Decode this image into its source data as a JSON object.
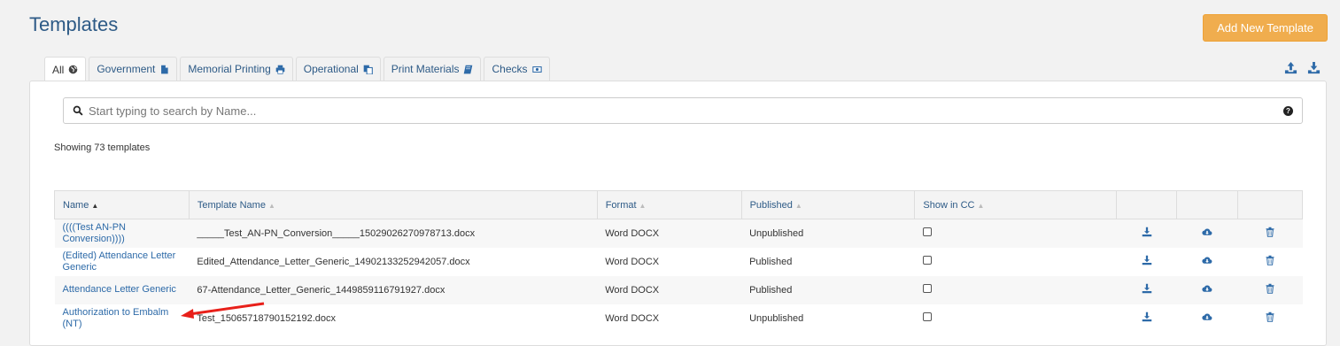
{
  "title": "Templates",
  "add_button": "Add New Template",
  "tabs": [
    {
      "label": "All",
      "icon": "globe-icon",
      "active": true
    },
    {
      "label": "Government",
      "icon": "file-icon"
    },
    {
      "label": "Memorial Printing",
      "icon": "print-icon"
    },
    {
      "label": "Operational",
      "icon": "copy-icon"
    },
    {
      "label": "Print Materials",
      "icon": "book-icon"
    },
    {
      "label": "Checks",
      "icon": "money-icon"
    }
  ],
  "search": {
    "placeholder": "Start typing to search by Name..."
  },
  "showing": "Showing 73 templates",
  "columns": {
    "name": "Name",
    "template_name": "Template Name",
    "format": "Format",
    "published": "Published",
    "show_in_cc": "Show in CC"
  },
  "rows": [
    {
      "name": "((((Test AN-PN Conversion))))",
      "template_name": "_____Test_AN-PN_Conversion_____15029026270978713.docx",
      "format": "Word DOCX",
      "published": "Unpublished"
    },
    {
      "name": "(Edited) Attendance Letter Generic",
      "template_name": "Edited_Attendance_Letter_Generic_14902133252942057.docx",
      "format": "Word DOCX",
      "published": "Published"
    },
    {
      "name": "Attendance Letter Generic",
      "template_name": "67-Attendance_Letter_Generic_1449859116791927.docx",
      "format": "Word DOCX",
      "published": "Published"
    },
    {
      "name": "Authorization to Embalm (NT)",
      "template_name": "Test_15065718790152192.docx",
      "format": "Word DOCX",
      "published": "Unpublished"
    }
  ],
  "colors": {
    "accent": "#2d6aa8",
    "button": "#f0ad4e",
    "annotation": "#e8201a"
  }
}
